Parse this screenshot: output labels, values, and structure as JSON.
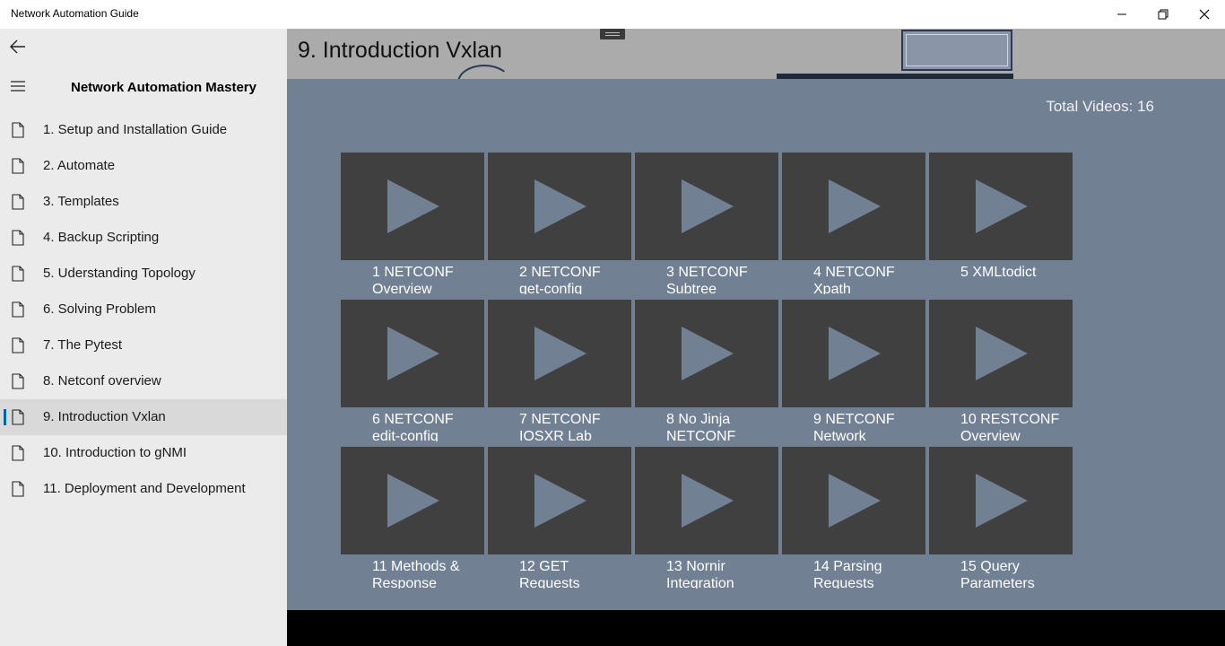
{
  "window": {
    "title": "Network Automation Guide",
    "controls": [
      "minimize-icon",
      "restore-icon",
      "close-icon"
    ]
  },
  "sidebar": {
    "title": "Network Automation Mastery",
    "selected_index": 8,
    "items": [
      {
        "label": "1. Setup and Installation Guide"
      },
      {
        "label": "2. Automate"
      },
      {
        "label": "3. Templates"
      },
      {
        "label": "4. Backup Scripting"
      },
      {
        "label": "5. Uderstanding Topology"
      },
      {
        "label": "6. Solving Problem"
      },
      {
        "label": "7. The Pytest"
      },
      {
        "label": "8. Netconf overview"
      },
      {
        "label": "9. Introduction Vxlan"
      },
      {
        "label": "10. Introduction to gNMI"
      },
      {
        "label": "11. Deployment and Development"
      }
    ]
  },
  "main": {
    "page_title": "9. Introduction Vxlan",
    "total_videos": "Total Videos: 16",
    "videos": [
      {
        "caption": "1 NETCONF Overview"
      },
      {
        "caption": "2 NETCONF get-config"
      },
      {
        "caption": "3 NETCONF Subtree"
      },
      {
        "caption": "4 NETCONF Xpath"
      },
      {
        "caption": "5 XMLtodict"
      },
      {
        "caption": "6 NETCONF edit-config"
      },
      {
        "caption": "7 NETCONF IOSXR Lab"
      },
      {
        "caption": "8 No Jinja NETCONF"
      },
      {
        "caption": "9 NETCONF Network"
      },
      {
        "caption": "10 RESTCONF Overview"
      },
      {
        "caption": "11 Methods & Response"
      },
      {
        "caption": "12 GET Requests"
      },
      {
        "caption": "13 Nornir Integration"
      },
      {
        "caption": "14 Parsing Requests"
      },
      {
        "caption": "15 Query Parameters"
      }
    ]
  },
  "colors": {
    "content_bg": "#718093",
    "tile_bg": "#404040",
    "play_icon": "#718093",
    "sidebar_bg": "#ebebeb",
    "accent": "#0063b1"
  }
}
